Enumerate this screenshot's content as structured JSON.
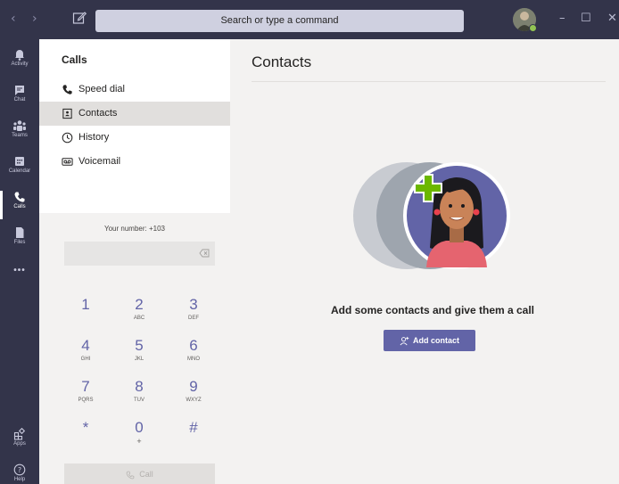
{
  "titlebar": {
    "search_placeholder": "Search or type a command",
    "back_glyph": "‹",
    "forward_glyph": "›",
    "minimize_glyph": "–",
    "maximize_glyph": "☐",
    "close_glyph": "✕"
  },
  "rail": {
    "items": [
      {
        "label": "Activity",
        "icon": "bell-icon"
      },
      {
        "label": "Chat",
        "icon": "chat-icon"
      },
      {
        "label": "Teams",
        "icon": "teams-icon"
      },
      {
        "label": "Calendar",
        "icon": "calendar-icon"
      },
      {
        "label": "Calls",
        "icon": "phone-icon",
        "active": true
      },
      {
        "label": "Files",
        "icon": "file-icon"
      }
    ],
    "more_glyph": "•••",
    "bottom": [
      {
        "label": "Apps",
        "icon": "apps-icon"
      },
      {
        "label": "Help",
        "icon": "help-icon"
      }
    ]
  },
  "pane": {
    "title": "Calls",
    "menu": [
      {
        "label": "Speed dial",
        "icon": "phone-icon"
      },
      {
        "label": "Contacts",
        "icon": "contact-card-icon",
        "selected": true
      },
      {
        "label": "History",
        "icon": "clock-icon"
      },
      {
        "label": "Voicemail",
        "icon": "voicemail-icon"
      }
    ]
  },
  "dialpad": {
    "your_number": "Your number: +103",
    "keys": [
      {
        "digit": "1",
        "letters": ""
      },
      {
        "digit": "2",
        "letters": "ABC"
      },
      {
        "digit": "3",
        "letters": "DEF"
      },
      {
        "digit": "4",
        "letters": "GHI"
      },
      {
        "digit": "5",
        "letters": "JKL"
      },
      {
        "digit": "6",
        "letters": "MNO"
      },
      {
        "digit": "7",
        "letters": "PQRS"
      },
      {
        "digit": "8",
        "letters": "TUV"
      },
      {
        "digit": "9",
        "letters": "WXYZ"
      },
      {
        "digit": "*",
        "letters": ""
      },
      {
        "digit": "0",
        "letters": "+"
      },
      {
        "digit": "#",
        "letters": ""
      }
    ],
    "call_label": "Call"
  },
  "main": {
    "title": "Contacts",
    "empty_message": "Add some contacts and give them a call",
    "add_contact_label": "Add contact"
  },
  "colors": {
    "accent": "#6264a7",
    "titlebar": "#33344a",
    "presence": "#92c353",
    "plus": "#6bb700"
  }
}
